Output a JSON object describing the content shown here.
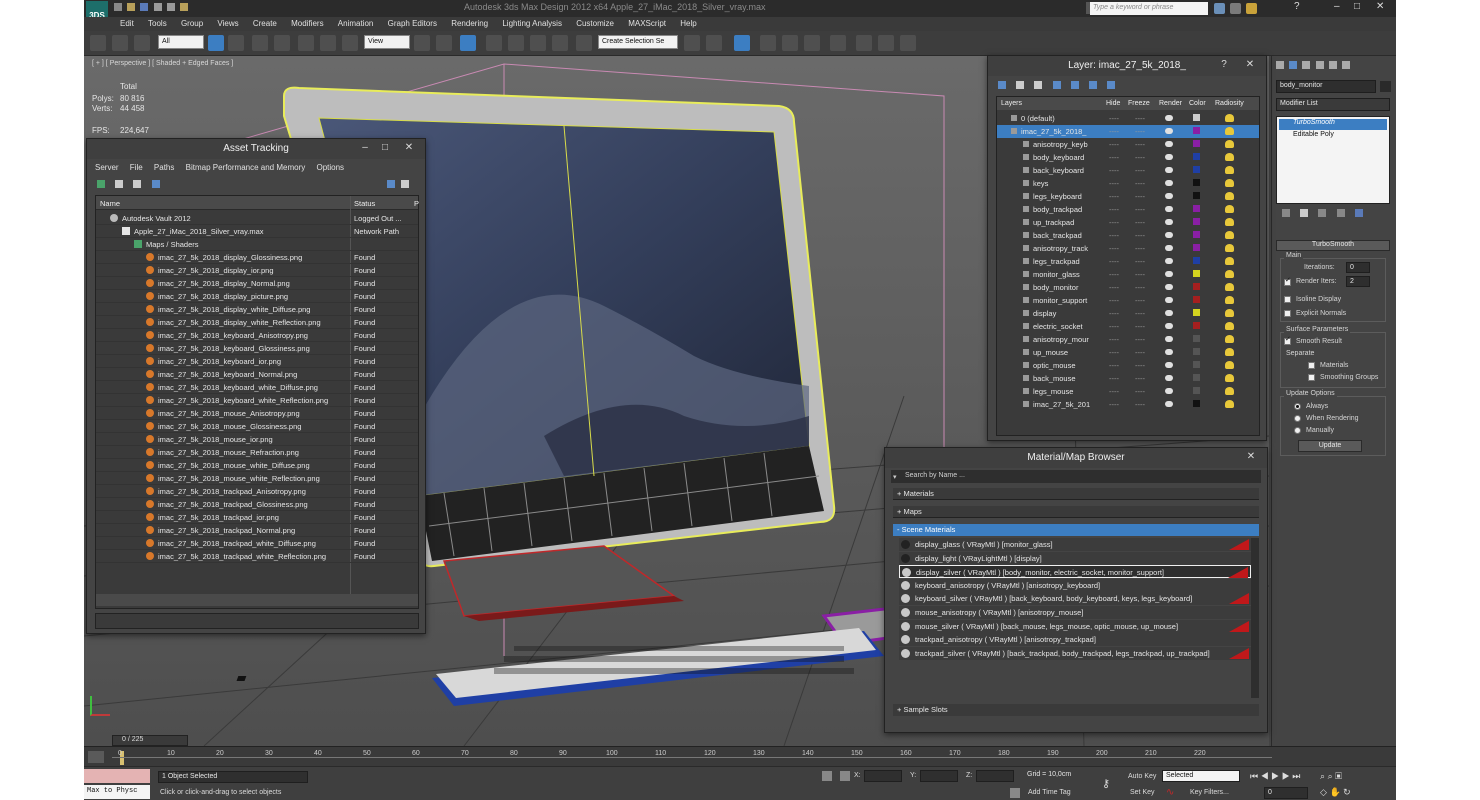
{
  "app": {
    "title": "Autodesk 3ds Max Design 2012 x64      Apple_27_iMac_2018_Silver_vray.max",
    "logo": "3DS",
    "search_placeholder": "Type a keyword or phrase",
    "menus": [
      "Edit",
      "Tools",
      "Group",
      "Views",
      "Create",
      "Modifiers",
      "Animation",
      "Graph Editors",
      "Rendering",
      "Lighting Analysis",
      "Customize",
      "MAXScript",
      "Help"
    ]
  },
  "toolbar": {
    "selection_filter": "All",
    "ref_coord": "View",
    "named_selection": "Create Selection Se"
  },
  "viewport": {
    "label": "[ + ] [ Perspective ] [ Shaded + Edged Faces ]",
    "stats": {
      "total_label": "Total",
      "polys_label": "Polys:",
      "polys_value": "80 816",
      "verts_label": "Verts:",
      "verts_value": "44 458",
      "fps_label": "FPS:",
      "fps_value": "224,647"
    }
  },
  "asset_tracking": {
    "title": "Asset Tracking",
    "menus": [
      "Server",
      "File",
      "Paths",
      "Bitmap Performance and Memory",
      "Options"
    ],
    "col_name": "Name",
    "col_status": "Status",
    "col_path": "P",
    "rows": [
      {
        "name": "Autodesk Vault 2012",
        "status": "Logged Out ..."
      },
      {
        "name": "Apple_27_iMac_2018_Silver_vray.max",
        "status": "Network Path"
      },
      {
        "name": "Maps / Shaders",
        "status": ""
      },
      {
        "name": "imac_27_5k_2018_display_Glossiness.png",
        "status": "Found"
      },
      {
        "name": "imac_27_5k_2018_display_ior.png",
        "status": "Found"
      },
      {
        "name": "imac_27_5k_2018_display_Normal.png",
        "status": "Found"
      },
      {
        "name": "imac_27_5k_2018_display_picture.png",
        "status": "Found"
      },
      {
        "name": "imac_27_5k_2018_display_white_Diffuse.png",
        "status": "Found"
      },
      {
        "name": "imac_27_5k_2018_display_white_Reflection.png",
        "status": "Found"
      },
      {
        "name": "imac_27_5k_2018_keyboard_Anisotropy.png",
        "status": "Found"
      },
      {
        "name": "imac_27_5k_2018_keyboard_Glossiness.png",
        "status": "Found"
      },
      {
        "name": "imac_27_5k_2018_keyboard_ior.png",
        "status": "Found"
      },
      {
        "name": "imac_27_5k_2018_keyboard_Normal.png",
        "status": "Found"
      },
      {
        "name": "imac_27_5k_2018_keyboard_white_Diffuse.png",
        "status": "Found"
      },
      {
        "name": "imac_27_5k_2018_keyboard_white_Reflection.png",
        "status": "Found"
      },
      {
        "name": "imac_27_5k_2018_mouse_Anisotropy.png",
        "status": "Found"
      },
      {
        "name": "imac_27_5k_2018_mouse_Glossiness.png",
        "status": "Found"
      },
      {
        "name": "imac_27_5k_2018_mouse_ior.png",
        "status": "Found"
      },
      {
        "name": "imac_27_5k_2018_mouse_Refraction.png",
        "status": "Found"
      },
      {
        "name": "imac_27_5k_2018_mouse_white_Diffuse.png",
        "status": "Found"
      },
      {
        "name": "imac_27_5k_2018_mouse_white_Reflection.png",
        "status": "Found"
      },
      {
        "name": "imac_27_5k_2018_trackpad_Anisotropy.png",
        "status": "Found"
      },
      {
        "name": "imac_27_5k_2018_trackpad_Glossiness.png",
        "status": "Found"
      },
      {
        "name": "imac_27_5k_2018_trackpad_ior.png",
        "status": "Found"
      },
      {
        "name": "imac_27_5k_2018_trackpad_Normal.png",
        "status": "Found"
      },
      {
        "name": "imac_27_5k_2018_trackpad_white_Diffuse.png",
        "status": "Found"
      },
      {
        "name": "imac_27_5k_2018_trackpad_white_Reflection.png",
        "status": "Found"
      }
    ]
  },
  "layer_dialog": {
    "title": "Layer: imac_27_5k_2018_",
    "help": "?",
    "columns": [
      "Layers",
      "Hide",
      "Freeze",
      "Render",
      "Color",
      "Radiosity"
    ],
    "rows": [
      {
        "name": "0 (default)",
        "color": "#cccccc",
        "level": 0
      },
      {
        "name": "imac_27_5k_2018_",
        "color": "#8a1fa5",
        "level": 0,
        "selected": true
      },
      {
        "name": "anisotropy_keyb",
        "color": "#8a1fa5",
        "level": 1
      },
      {
        "name": "body_keyboard",
        "color": "#1f3fa5",
        "level": 1
      },
      {
        "name": "back_keyboard",
        "color": "#1f3fa5",
        "level": 1
      },
      {
        "name": "keys",
        "color": "#111111",
        "level": 1
      },
      {
        "name": "legs_keyboard",
        "color": "#111111",
        "level": 1
      },
      {
        "name": "body_trackpad",
        "color": "#8a1fa5",
        "level": 1
      },
      {
        "name": "up_trackpad",
        "color": "#8a1fa5",
        "level": 1
      },
      {
        "name": "back_trackpad",
        "color": "#8a1fa5",
        "level": 1
      },
      {
        "name": "anisotropy_track",
        "color": "#8a1fa5",
        "level": 1
      },
      {
        "name": "legs_trackpad",
        "color": "#1f3fa5",
        "level": 1
      },
      {
        "name": "monitor_glass",
        "color": "#d4d41f",
        "level": 1
      },
      {
        "name": "body_monitor",
        "color": "#a51f1f",
        "level": 1
      },
      {
        "name": "monitor_support",
        "color": "#a51f1f",
        "level": 1
      },
      {
        "name": "display",
        "color": "#d4d41f",
        "level": 1
      },
      {
        "name": "electric_socket",
        "color": "#a51f1f",
        "level": 1
      },
      {
        "name": "anisotropy_mour",
        "color": "#555555",
        "level": 1
      },
      {
        "name": "up_mouse",
        "color": "#555555",
        "level": 1
      },
      {
        "name": "optic_mouse",
        "color": "#555555",
        "level": 1
      },
      {
        "name": "back_mouse",
        "color": "#555555",
        "level": 1
      },
      {
        "name": "legs_mouse",
        "color": "#555555",
        "level": 1
      },
      {
        "name": "imac_27_5k_201",
        "color": "#111111",
        "level": 1
      }
    ]
  },
  "material_browser": {
    "title": "Material/Map Browser",
    "search_placeholder": "Search by Name ...",
    "sections": [
      "+ Materials",
      "+ Maps",
      "- Scene Materials",
      "+ Sample Slots"
    ],
    "materials": [
      {
        "label": "display_glass  ( VRayMtl )  [monitor_glass]",
        "flag": true
      },
      {
        "label": "display_light  ( VRayLightMtl )  [display]",
        "flag": false
      },
      {
        "label": "display_silver  ( VRayMtl )  [body_monitor, electric_socket, monitor_support]",
        "flag": true,
        "selected": true
      },
      {
        "label": "keyboard_anisotropy  ( VRayMtl )  [anisotropy_keyboard]",
        "flag": false
      },
      {
        "label": "keyboard_silver  ( VRayMtl )  [back_keyboard, body_keyboard, keys, legs_keyboard]",
        "flag": true
      },
      {
        "label": "mouse_anisotropy  ( VRayMtl )  [anisotropy_mouse]",
        "flag": false
      },
      {
        "label": "mouse_silver  ( VRayMtl )  [back_mouse, legs_mouse, optic_mouse, up_mouse]",
        "flag": true
      },
      {
        "label": "trackpad_anisotropy  ( VRayMtl )  [anisotropy_trackpad]",
        "flag": false
      },
      {
        "label": "trackpad_silver  ( VRayMtl )  [back_trackpad, body_trackpad, legs_trackpad, up_trackpad]",
        "flag": true
      }
    ]
  },
  "command_panel": {
    "object_name": "body_monitor",
    "modifier_list": "Modifier List",
    "stack": [
      "TurboSmooth",
      "Editable Poly"
    ],
    "rollout_title": "TurboSmooth",
    "main_label": "Main",
    "iterations_label": "Iterations:",
    "iterations_value": "0",
    "render_iters_label": "Render Iters:",
    "render_iters_value": "2",
    "render_iters_checked": true,
    "isoline_label": "Isoline Display",
    "explicit_normals_label": "Explicit Normals",
    "surface_params_label": "Surface Parameters",
    "smooth_result_label": "Smooth Result",
    "separate_label": "Separate",
    "materials_label": "Materials",
    "smoothing_groups_label": "Smoothing Groups",
    "update_options_label": "Update Options",
    "always_label": "Always",
    "when_rendering_label": "When Rendering",
    "manually_label": "Manually",
    "update_button": "Update"
  },
  "timeline": {
    "frame_counter": "0 / 225",
    "ticks": [
      "0",
      "10",
      "20",
      "30",
      "40",
      "50",
      "60",
      "70",
      "80",
      "90",
      "100",
      "110",
      "120",
      "130",
      "140",
      "150",
      "160",
      "170",
      "180",
      "190",
      "200",
      "210",
      "220"
    ]
  },
  "status_bar": {
    "script_listener": "Max to Physc",
    "selection": "1 Object Selected",
    "prompt": "Click or click-and-drag to select objects",
    "x_label": "X:",
    "y_label": "Y:",
    "z_label": "Z:",
    "grid": "Grid = 10,0cm",
    "add_time_tag": "Add Time Tag",
    "auto_key": "Auto Key",
    "set_key": "Set Key",
    "key_mode": "Selected",
    "key_filters": "Key Filters...",
    "frame": "0"
  }
}
